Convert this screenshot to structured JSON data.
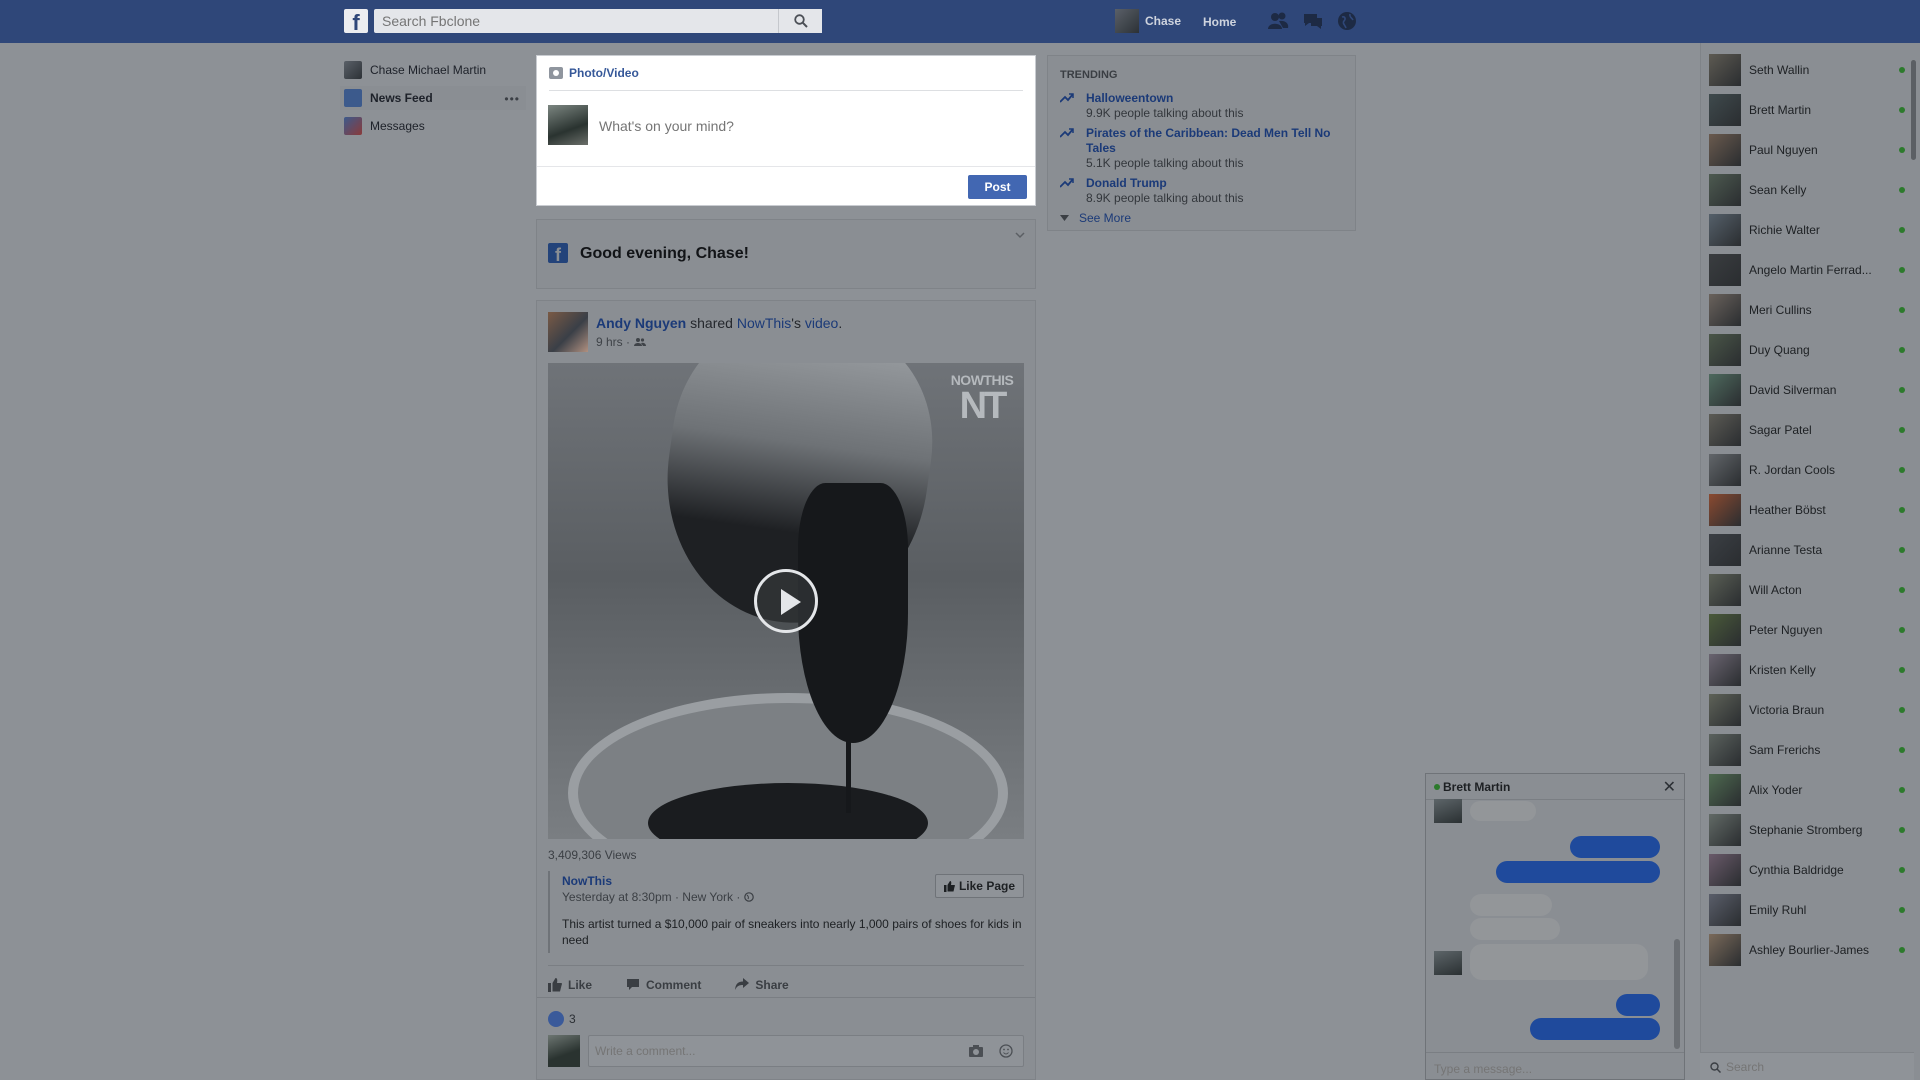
{
  "header": {
    "logo": "f",
    "search_placeholder": "Search Fbclone",
    "user_name": "Chase",
    "home_label": "Home",
    "icons": [
      "friends-icon",
      "messages-icon",
      "globe-icon"
    ]
  },
  "leftnav": {
    "items": [
      {
        "label": "Chase Michael Martin",
        "icon": "profile-avatar"
      },
      {
        "label": "News Feed",
        "icon": "news-feed-icon",
        "active": true,
        "more": "•••"
      },
      {
        "label": "Messages",
        "icon": "messages-icon"
      }
    ]
  },
  "composer": {
    "tab_label": "Photo/Video",
    "placeholder": "What's on your mind?",
    "post_label": "Post"
  },
  "greeting": {
    "logo": "f",
    "text": "Good evening, Chase!"
  },
  "post": {
    "author": "Andy Nguyen",
    "shared_word": " shared ",
    "page": "NowThis",
    "possessive": "'s ",
    "object": "video",
    "period": ".",
    "time": "9 hrs ·",
    "watermark_top": "NOWTHIS",
    "watermark_big": "NT",
    "views": "3,409,306 Views",
    "shared": {
      "page": "NowThis",
      "meta": "Yesterday at 8:30pm · New York ·",
      "description": "This artist turned a $10,000 pair of sneakers into nearly 1,000 pairs of shoes for kids in need",
      "like_page_label": "Like Page"
    },
    "actions": {
      "like": "Like",
      "comment": "Comment",
      "share": "Share"
    },
    "like_count": "3",
    "comment_placeholder": "Write a comment..."
  },
  "trending": {
    "title": "TRENDING",
    "items": [
      {
        "title": "Halloweentown",
        "sub": "9.9K people talking about this"
      },
      {
        "title": "Pirates of the Caribbean: Dead Men Tell No Tales",
        "sub": "5.1K people talking about this"
      },
      {
        "title": "Donald Trump",
        "sub": "8.9K people talking about this"
      }
    ],
    "see_more": "See More"
  },
  "chat_sidebar": {
    "friends": [
      "Seth Wallin",
      "Brett Martin",
      "Paul Nguyen",
      "Sean Kelly",
      "Richie Walter",
      "Angelo Martin Ferrad...",
      "Meri Cullins",
      "Duy Quang",
      "David Silverman",
      "Sagar Patel",
      "R. Jordan Cools",
      "Heather Böbst",
      "Arianne Testa",
      "Will Acton",
      "Peter Nguyen",
      "Kristen Kelly",
      "Victoria Braun",
      "Sam Frerichs",
      "Alix Yoder",
      "Stephanie Stromberg",
      "Cynthia Baldridge",
      "Emily Ruhl",
      "Ashley Bourlier-James"
    ],
    "search_placeholder": "Search"
  },
  "chat_window": {
    "name": "Brett Martin",
    "close": "✕",
    "input_placeholder": "Type a message..."
  },
  "colors": {
    "topbar": "#2f4779",
    "link": "#365899",
    "post_button": "#4267b2",
    "online": "#42b72a"
  }
}
